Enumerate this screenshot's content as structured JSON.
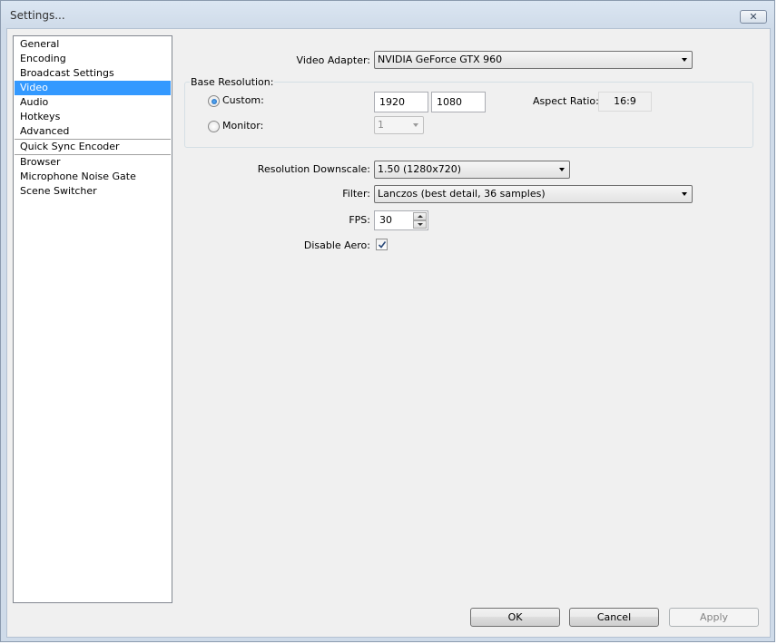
{
  "window": {
    "title": "Settings...",
    "close_glyph": "✕"
  },
  "sidebar": {
    "items": [
      {
        "label": "General"
      },
      {
        "label": "Encoding"
      },
      {
        "label": "Broadcast Settings"
      },
      {
        "label": "Video",
        "selected": true
      },
      {
        "label": "Audio"
      },
      {
        "label": "Hotkeys"
      },
      {
        "label": "Advanced"
      },
      {
        "label": "Quick Sync Encoder"
      },
      {
        "label": "Browser"
      },
      {
        "label": "Microphone Noise Gate"
      },
      {
        "label": "Scene Switcher"
      }
    ]
  },
  "video": {
    "adapter_label": "Video Adapter:",
    "adapter_value": "NVIDIA GeForce GTX 960",
    "base_resolution_label": "Base Resolution:",
    "custom_label": "Custom:",
    "custom_selected": true,
    "custom_width": "1920",
    "custom_height": "1080",
    "aspect_ratio_label": "Aspect Ratio:",
    "aspect_ratio_value": "16:9",
    "monitor_label": "Monitor:",
    "monitor_value": "1",
    "downscale_label": "Resolution Downscale:",
    "downscale_value": "1.50  (1280x720)",
    "filter_label": "Filter:",
    "filter_value": "Lanczos (best detail, 36 samples)",
    "fps_label": "FPS:",
    "fps_value": "30",
    "disable_aero_label": "Disable Aero:",
    "disable_aero_checked": true
  },
  "buttons": {
    "ok": "OK",
    "cancel": "Cancel",
    "apply": "Apply"
  },
  "colors": {
    "selection": "#3399ff"
  }
}
